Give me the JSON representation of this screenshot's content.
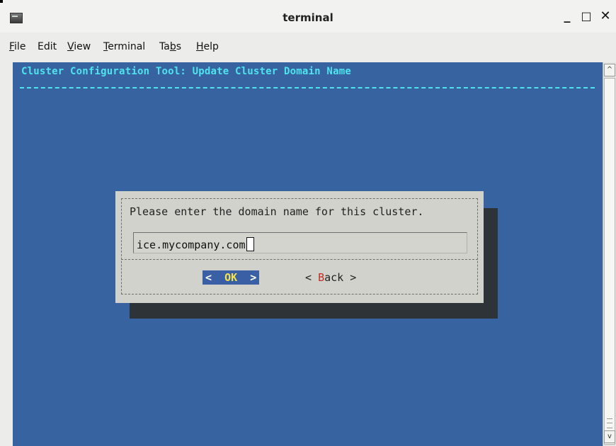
{
  "window": {
    "title": "terminal",
    "minimize_glyph": "_",
    "maximize_glyph": "□",
    "close_glyph": "✕"
  },
  "menubar": {
    "items": [
      {
        "label_under": "F",
        "label_rest": "ile"
      },
      {
        "label_under": "",
        "label_rest": "Edit"
      },
      {
        "label_under": "V",
        "label_rest": "iew"
      },
      {
        "label_under": "T",
        "label_rest": "erminal"
      },
      {
        "label_pre": "Ta",
        "label_under": "b",
        "label_rest": "s"
      },
      {
        "label_under": "H",
        "label_rest": "elp"
      }
    ]
  },
  "terminal": {
    "header": "Cluster Configuration Tool: Update Cluster Domain Name",
    "dialog": {
      "prompt": "Please enter the domain name for this cluster.",
      "input_value": "ice.mycompany.com",
      "ok_left": "<  ",
      "ok_hot": "OK",
      "ok_right": "  >",
      "back_left": "< ",
      "back_hot": "B",
      "back_right": "ack >"
    }
  },
  "scrollbar": {
    "up_glyph": "^",
    "down_glyph": "v"
  }
}
